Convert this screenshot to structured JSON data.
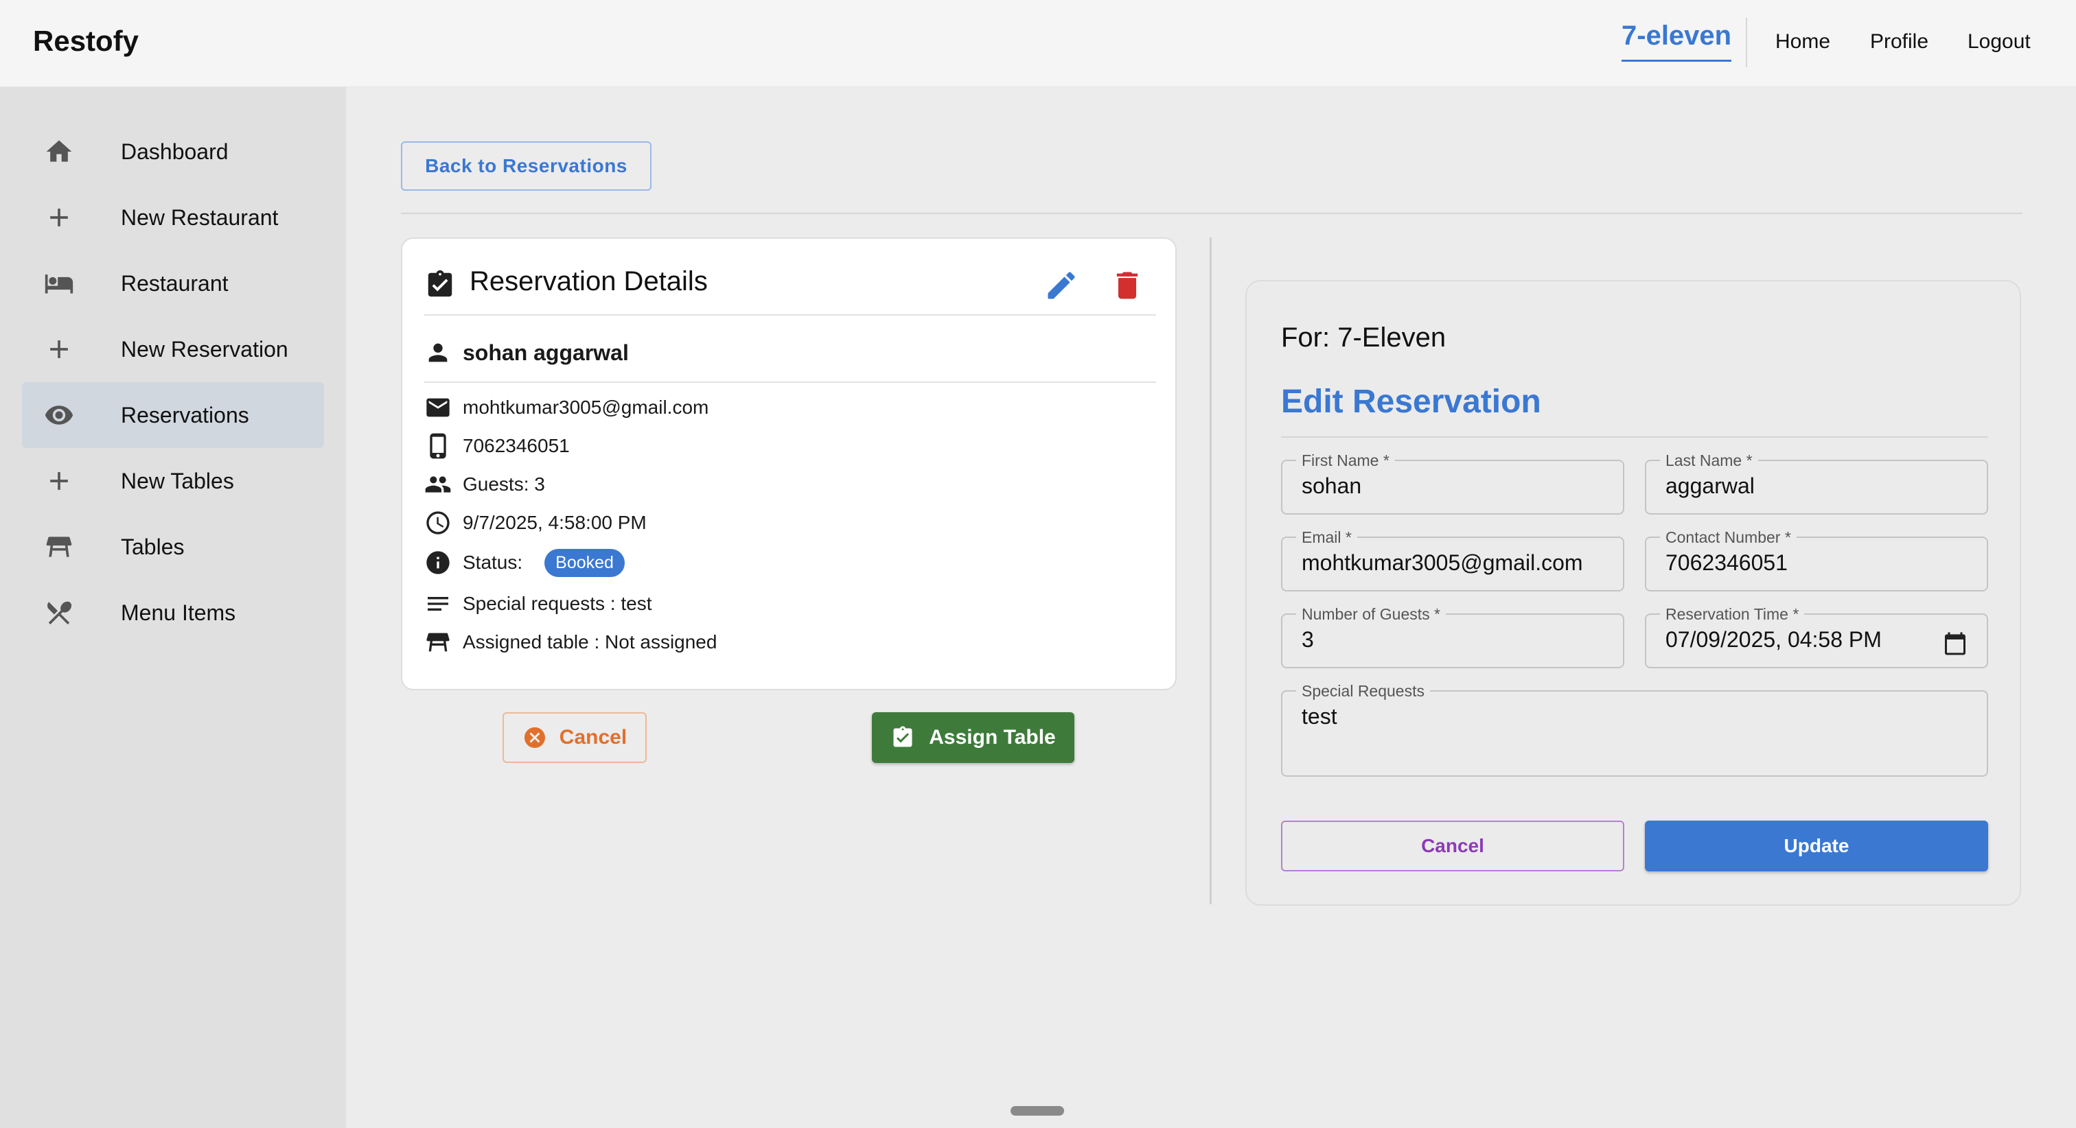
{
  "app": {
    "brand": "Restofy"
  },
  "header": {
    "restaurant_name": "7-eleven",
    "links": {
      "home": "Home",
      "profile": "Profile",
      "logout": "Logout"
    }
  },
  "sidebar": {
    "items": [
      {
        "label": "Dashboard",
        "icon": "home-icon"
      },
      {
        "label": "New Restaurant",
        "icon": "plus-icon"
      },
      {
        "label": "Restaurant",
        "icon": "bed-icon"
      },
      {
        "label": "New Reservation",
        "icon": "plus-icon"
      },
      {
        "label": "Reservations",
        "icon": "eye-icon",
        "active": true
      },
      {
        "label": "New Tables",
        "icon": "plus-icon"
      },
      {
        "label": "Tables",
        "icon": "table-icon"
      },
      {
        "label": "Menu Items",
        "icon": "utensils-icon"
      }
    ]
  },
  "main": {
    "back_button": "Back to Reservations",
    "details": {
      "title": "Reservation Details",
      "name": "sohan aggarwal",
      "email": "mohtkumar3005@gmail.com",
      "phone": "7062346051",
      "guests": "Guests: 3",
      "datetime": "9/7/2025, 4:58:00 PM",
      "status_label": "Status:",
      "status_value": "Booked",
      "special_requests": "Special requests : test",
      "assigned_table": "Assigned table : Not assigned"
    },
    "actions": {
      "cancel": "Cancel",
      "assign": "Assign Table"
    }
  },
  "edit_form": {
    "for_text": "For: 7-Eleven",
    "title": "Edit Reservation",
    "fields": {
      "first_name": {
        "label": "First Name *",
        "value": "sohan"
      },
      "last_name": {
        "label": "Last Name *",
        "value": "aggarwal"
      },
      "email": {
        "label": "Email *",
        "value": "mohtkumar3005@gmail.com"
      },
      "contact": {
        "label": "Contact Number *",
        "value": "7062346051"
      },
      "guests": {
        "label": "Number of Guests *",
        "value": "3"
      },
      "time": {
        "label": "Reservation Time *",
        "value": "07/09/2025, 04:58 PM"
      },
      "special": {
        "label": "Special Requests",
        "value": "test"
      }
    },
    "cancel": "Cancel",
    "update": "Update"
  },
  "colors": {
    "accent": "#3a78d2",
    "danger": "#d32f2f",
    "success": "#3e7b3b",
    "warning": "#e0702c",
    "secondary": "#8e3ab5"
  }
}
